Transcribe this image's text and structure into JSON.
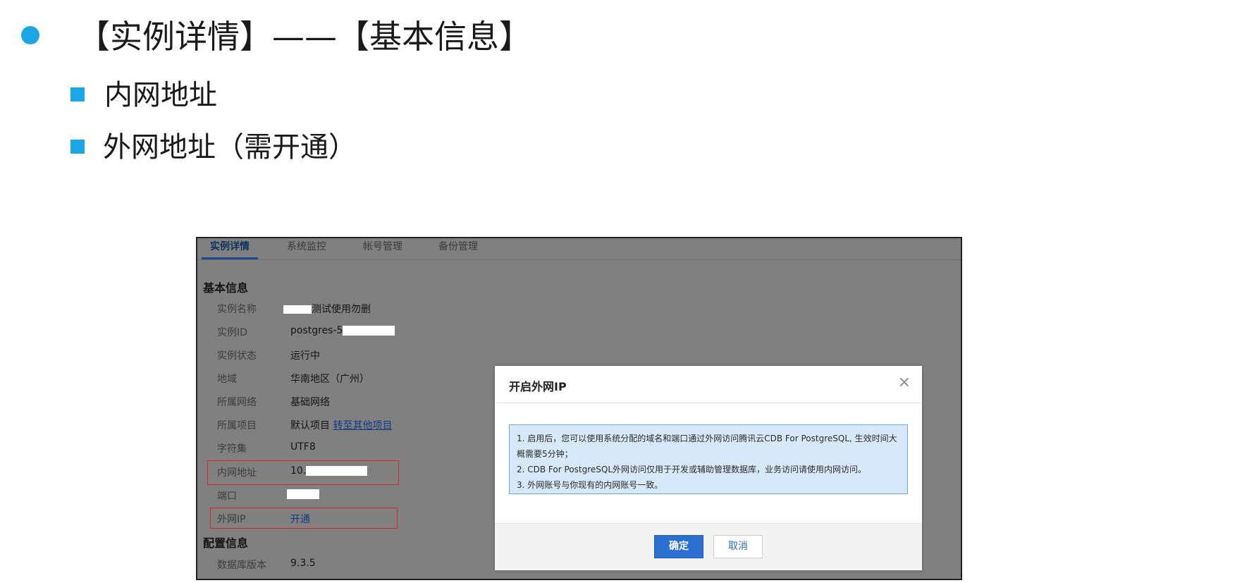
{
  "slide": {
    "title": "【实例详情】——【基本信息】",
    "bullets": [
      "内网地址",
      "外网地址（需开通）"
    ]
  },
  "colors": {
    "accent": "#1ba6e6",
    "primary_button": "#2b6fd1",
    "highlight_box": "#d92626",
    "notice_bg": "#d7e8f8"
  },
  "console": {
    "tabs": [
      {
        "label": "实例详情",
        "active": true
      },
      {
        "label": "系统监控",
        "active": false
      },
      {
        "label": "帐号管理",
        "active": false
      },
      {
        "label": "备份管理",
        "active": false
      }
    ],
    "basic_section": "基本信息",
    "rows": [
      {
        "label": "实例名称",
        "value": "测试使用勿删"
      },
      {
        "label": "实例ID",
        "value": "postgres-5"
      },
      {
        "label": "实例状态",
        "value": "运行中"
      },
      {
        "label": "地域",
        "value": "华南地区（广州）"
      },
      {
        "label": "所属网络",
        "value": "基础网络"
      },
      {
        "label": "所属项目",
        "value": "默认项目",
        "link": "转至其他项目"
      },
      {
        "label": "字符集",
        "value": "UTF8"
      },
      {
        "label": "内网地址",
        "value": "10."
      },
      {
        "label": "端口",
        "value": ""
      },
      {
        "label": "外网IP",
        "value": "开通"
      }
    ],
    "config_section": "配置信息",
    "config_rows": [
      {
        "label": "数据库版本",
        "value": "9.3.5"
      }
    ]
  },
  "dialog": {
    "title": "开启外网IP",
    "close_icon": "×",
    "notice_lines": [
      "1. 启用后，您可以使用系统分配的域名和端口通过外网访问腾讯云CDB For PostgreSQL, 生效时间大",
      "概需要5分钟；",
      "2. CDB For PostgreSQL外网访问仅用于开发或辅助管理数据库，业务访问请使用内网访问。",
      "3. 外网账号与你现有的内网账号一致。"
    ],
    "confirm_label": "确定",
    "cancel_label": "取消"
  }
}
